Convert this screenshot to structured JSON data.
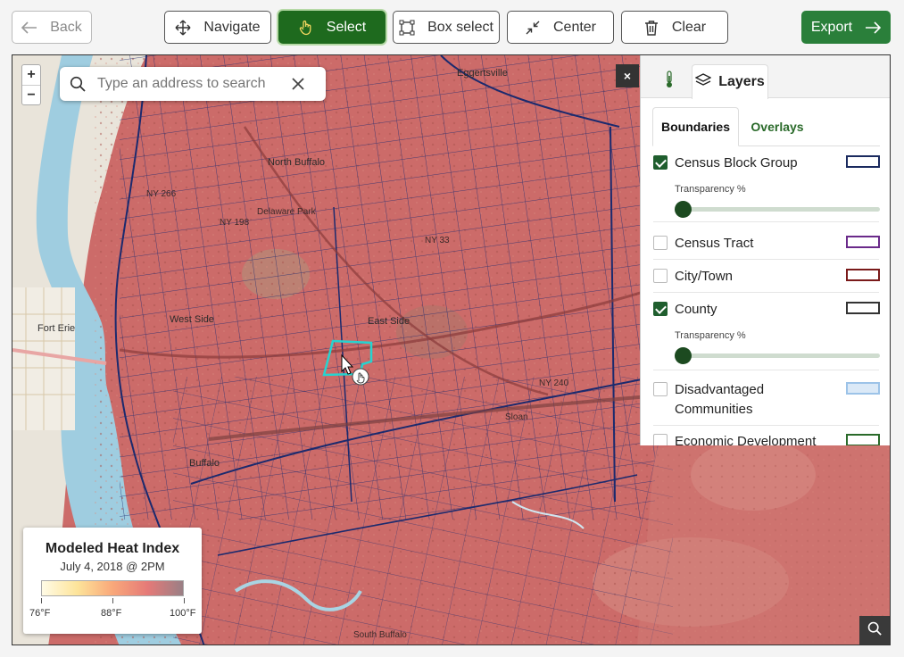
{
  "toolbar": {
    "back_label": "Back",
    "navigate_label": "Navigate",
    "select_label": "Select",
    "box_select_label": "Box select",
    "center_label": "Center",
    "clear_label": "Clear",
    "export_label": "Export"
  },
  "map": {
    "zoom_in": "+",
    "zoom_out": "−",
    "search_placeholder": "Type an address to search",
    "close_panel": "×",
    "labels": {
      "eggertsville": "Eggertsville",
      "north_buffalo": "North Buffalo",
      "delaware_park": "Delaware Park",
      "west_side": "West Side",
      "east_side": "East Side",
      "fort_erie": "Fort Erie",
      "buffalo": "Buffalo",
      "south_buffalo": "South Buffalo",
      "sloan": "Sloan",
      "ny240": "NY 240",
      "ny33": "NY 33",
      "ny198": "NY 198",
      "ny266": "NY 266"
    }
  },
  "panel": {
    "tab_layers": "Layers",
    "subtab_boundaries": "Boundaries",
    "subtab_overlays": "Overlays",
    "transparency_label": "Transparency %",
    "layers": [
      {
        "name": "Census Block Group",
        "checked": true,
        "color": "#1a2a5e"
      },
      {
        "name": "Census Tract",
        "checked": false,
        "color": "#6a2a8a"
      },
      {
        "name": "City/Town",
        "checked": false,
        "color": "#7a1a1a"
      },
      {
        "name": "County",
        "checked": true,
        "color": "#333333"
      },
      {
        "name": "Disadvantaged Communities",
        "checked": false,
        "color": "#9cc3e8"
      },
      {
        "name": "Economic Development",
        "checked": false,
        "color": "#2a6a2a"
      }
    ]
  },
  "legend": {
    "title": "Modeled Heat Index",
    "subtitle": "July 4, 2018 @ 2PM",
    "min_label": "76°F",
    "mid_label": "88°F",
    "max_label": "100°F"
  }
}
